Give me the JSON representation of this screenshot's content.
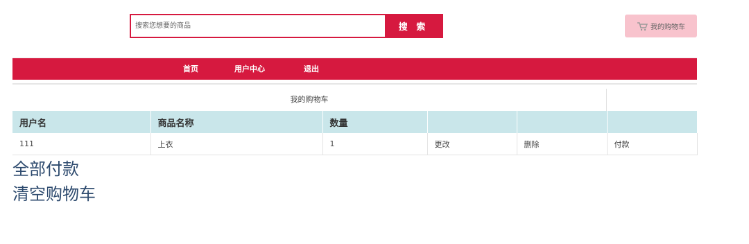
{
  "search": {
    "placeholder": "搜索您想要的商品",
    "button_label": "搜 索"
  },
  "cart_button": {
    "label": "我的购物车",
    "icon": "cart-icon"
  },
  "nav": {
    "items": [
      {
        "label": "首页"
      },
      {
        "label": "用户中心"
      },
      {
        "label": "退出"
      }
    ]
  },
  "cart": {
    "caption": "我的购物车",
    "headers": [
      "用户名",
      "商品名称",
      "数量",
      "",
      "",
      ""
    ],
    "rows": [
      {
        "username": "111",
        "product": "上衣",
        "quantity": "1",
        "edit": "更改",
        "delete": "删除",
        "pay": "付款"
      }
    ]
  },
  "actions": {
    "pay_all": "全部付款",
    "clear_cart": "清空购物车"
  },
  "colors": {
    "brand_red": "#d6193f",
    "cart_button_bg": "#f8c3cd",
    "table_header_bg": "#c9e6ea",
    "action_link": "#2d4a6e"
  }
}
